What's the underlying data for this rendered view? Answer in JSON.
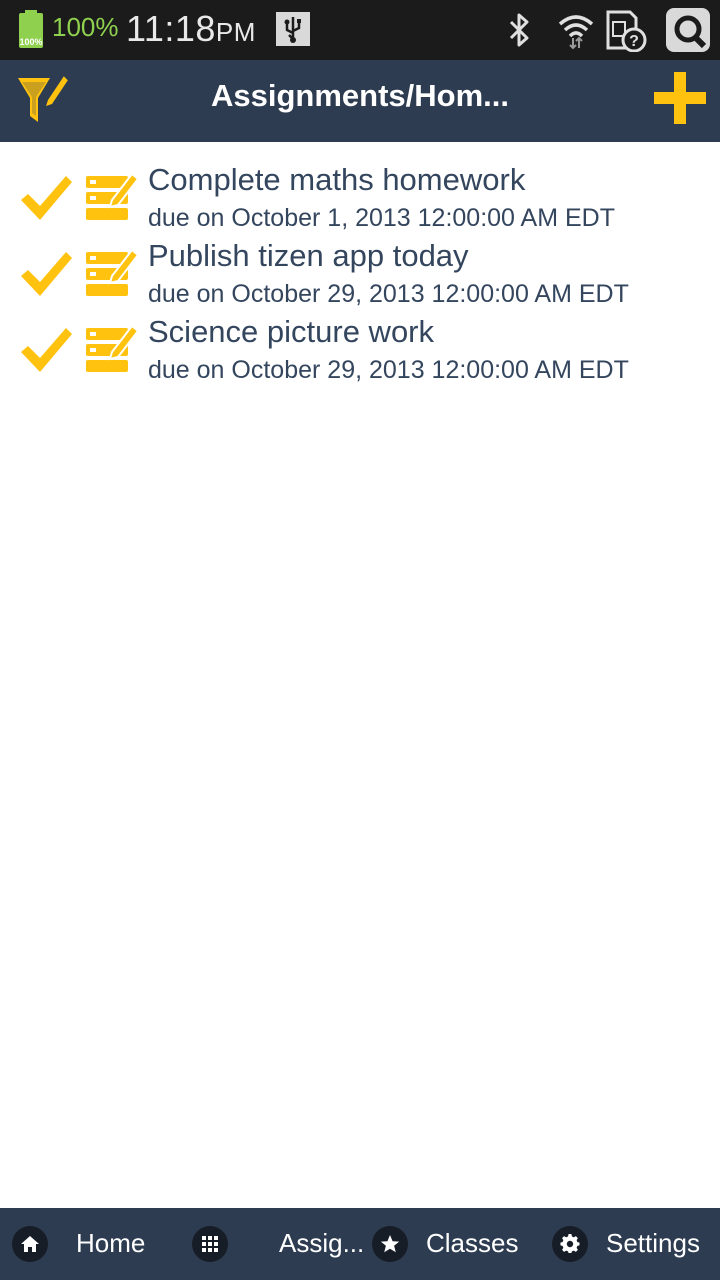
{
  "status_bar": {
    "battery_badge": "100%",
    "battery_percent": "100%",
    "time": "11:18",
    "ampm": "PM"
  },
  "header": {
    "title": "Assignments/Hom...",
    "filter_icon": "filter-icon",
    "add_icon": "plus-icon"
  },
  "assignments": [
    {
      "title": "Complete maths homework",
      "due": "due on October 1, 2013 12:00:00 AM EDT",
      "done": true
    },
    {
      "title": "Publish tizen app today",
      "due": "due on October 29, 2013 12:00:00 AM EDT",
      "done": true
    },
    {
      "title": "Science picture work",
      "due": "due on October 29, 2013 12:00:00 AM EDT",
      "done": true
    }
  ],
  "bottom_nav": [
    {
      "label": "Home",
      "icon": "home-icon"
    },
    {
      "label": "Assig...",
      "icon": "grid-icon"
    },
    {
      "label": "Classes",
      "icon": "star-icon"
    },
    {
      "label": "Settings",
      "icon": "gear-icon"
    }
  ],
  "colors": {
    "header_bg": "#2d3c51",
    "accent_yellow": "#ffc20e",
    "text": "#34465e",
    "battery_green": "#8fd14f"
  }
}
